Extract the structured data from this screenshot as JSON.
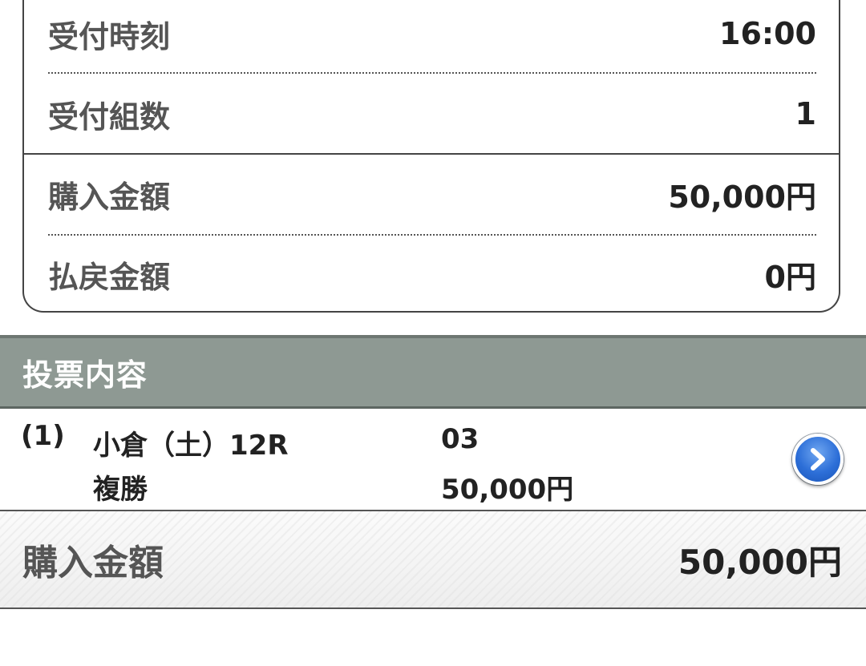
{
  "summary": {
    "rows": [
      {
        "label": "受付時刻",
        "value": "16:00"
      },
      {
        "label": "受付組数",
        "value": "1"
      },
      {
        "label": "購入金額",
        "value": "50,000円"
      },
      {
        "label": "払戻金額",
        "value": "0円"
      }
    ]
  },
  "section": {
    "title": "投票内容"
  },
  "bets": [
    {
      "index": "(1)",
      "race": "小倉（土）12R",
      "bet_type": "複勝",
      "combination": "03",
      "amount": "50,000円",
      "detail_icon": "chevron-right-icon"
    }
  ],
  "total": {
    "label": "購入金額",
    "value": "50,000円"
  },
  "colors": {
    "header_bg": "#8e9993",
    "arrow_blue": "#2d6fd8"
  }
}
